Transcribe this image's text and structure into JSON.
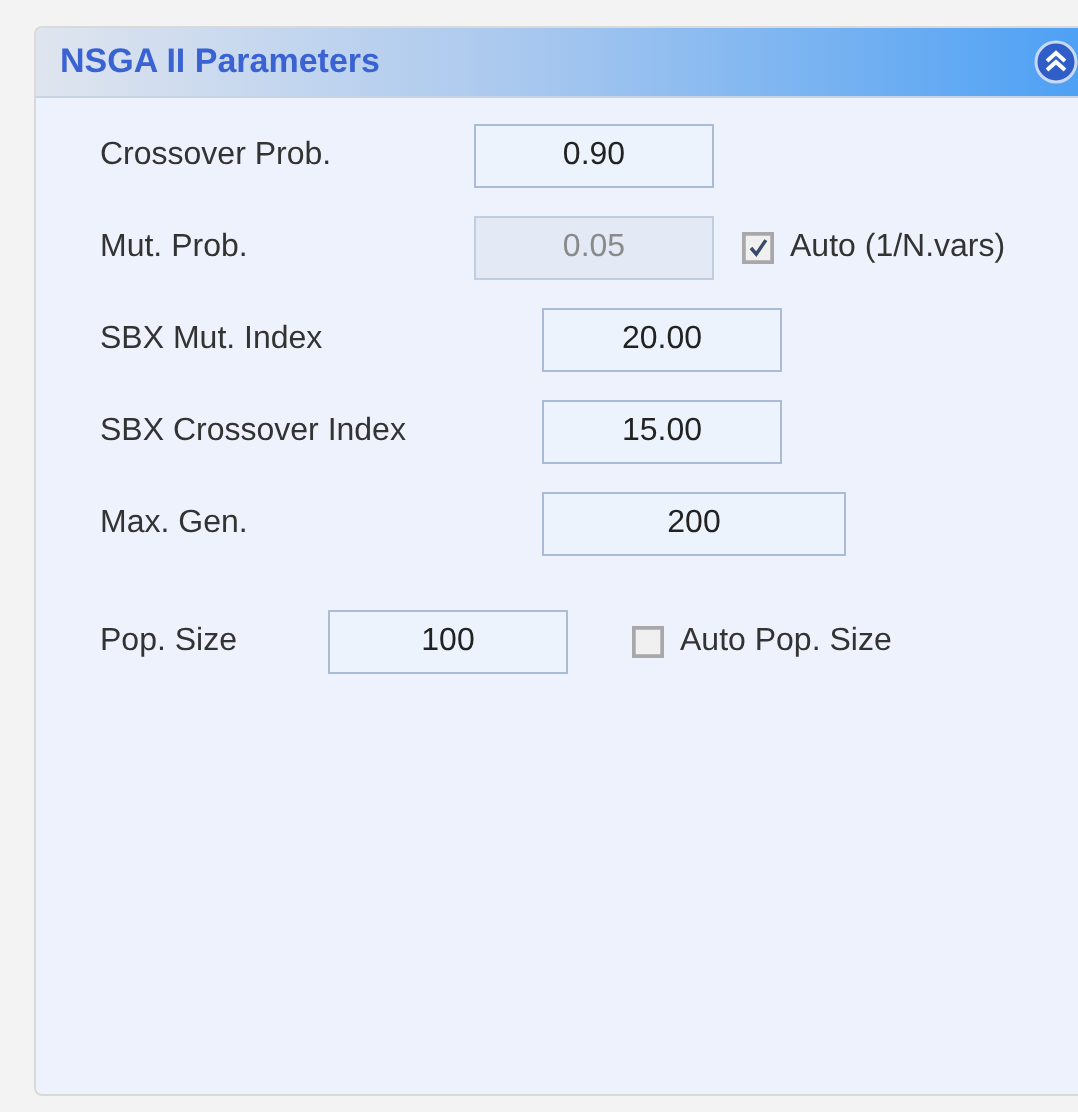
{
  "panel": {
    "title": "NSGA II Parameters"
  },
  "rows": [
    {
      "label": "Crossover Prob.",
      "value": "0.90",
      "disabled": false
    },
    {
      "label": "Mut. Prob.",
      "value": "0.05",
      "disabled": true,
      "checkbox": {
        "label": "Auto (1/N.vars)",
        "checked": true
      }
    },
    {
      "label": "SBX Mut. Index",
      "value": "20.00",
      "disabled": false
    },
    {
      "label": "SBX Crossover Index",
      "value": "15.00",
      "disabled": false
    },
    {
      "label": "Max. Gen.",
      "value": "200",
      "disabled": false
    },
    {
      "label": "Pop. Size",
      "value": "100",
      "disabled": false,
      "checkbox": {
        "label": "Auto Pop. Size",
        "checked": false
      }
    }
  ]
}
